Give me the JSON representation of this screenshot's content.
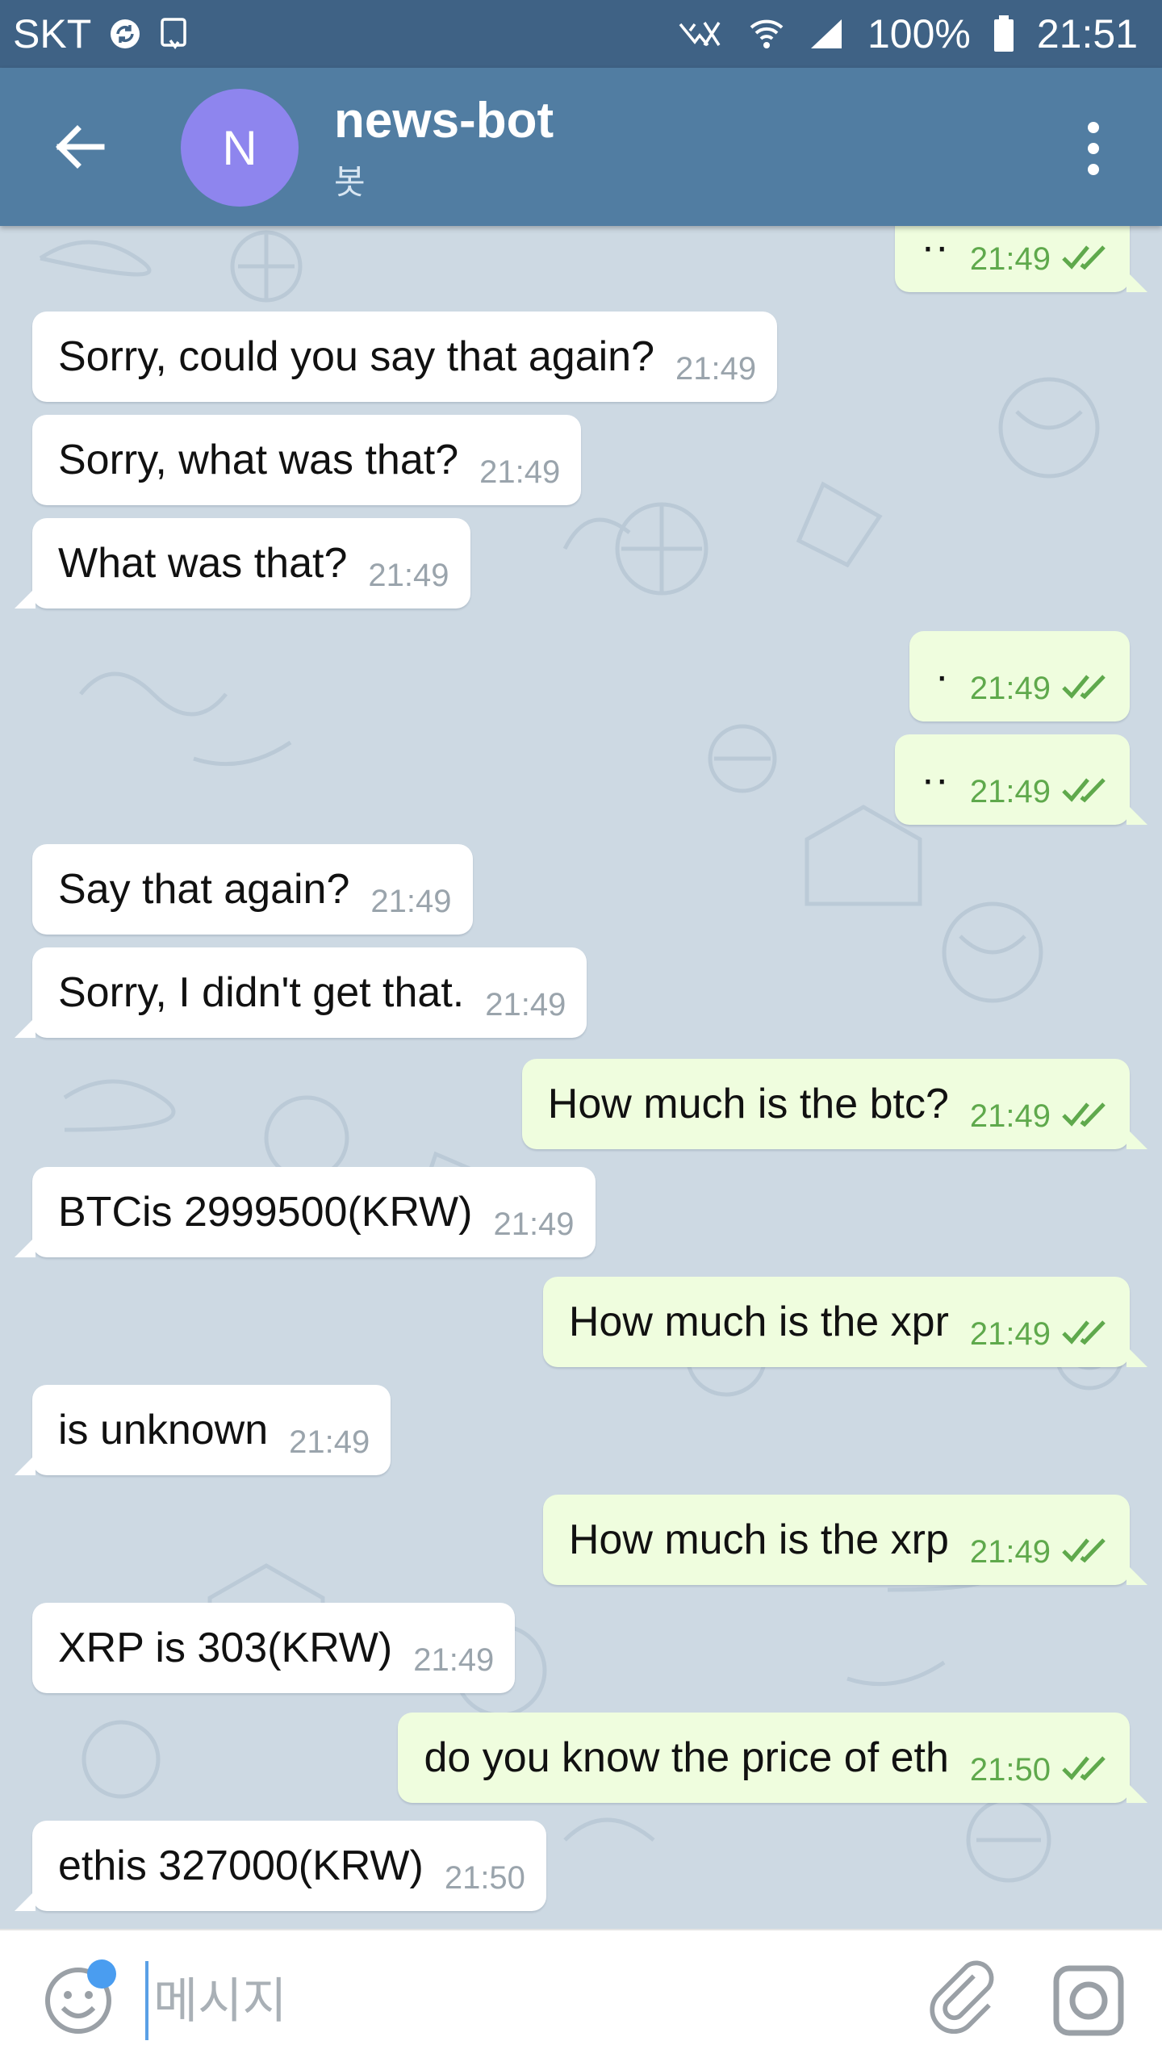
{
  "status_bar": {
    "carrier": "SKT",
    "battery": "100%",
    "time": "21:51"
  },
  "header": {
    "avatar_letter": "N",
    "title": "news-bot",
    "subtitle": "봇",
    "avatar_color": "#8e85ee",
    "bar_color": "#517da2"
  },
  "messages": [
    {
      "dir": "out",
      "text": "··",
      "time": "21:49",
      "read": true
    },
    {
      "dir": "in",
      "text": "Sorry, could you say that again?",
      "time": "21:49"
    },
    {
      "dir": "in",
      "text": "Sorry, what was that?",
      "time": "21:49"
    },
    {
      "dir": "in",
      "text": "What was that?",
      "time": "21:49"
    },
    {
      "dir": "out",
      "text": "·",
      "time": "21:49",
      "read": true
    },
    {
      "dir": "out",
      "text": "··",
      "time": "21:49",
      "read": true
    },
    {
      "dir": "in",
      "text": "Say that again?",
      "time": "21:49"
    },
    {
      "dir": "in",
      "text": "Sorry, I didn't get that.",
      "time": "21:49"
    },
    {
      "dir": "out",
      "text": "How much is the btc?",
      "time": "21:49",
      "read": true
    },
    {
      "dir": "in",
      "text": "BTCis 2999500(KRW)",
      "time": "21:49"
    },
    {
      "dir": "out",
      "text": "How much is the xpr",
      "time": "21:49",
      "read": true
    },
    {
      "dir": "in",
      "text": "is unknown",
      "time": "21:49"
    },
    {
      "dir": "out",
      "text": "How much is the xrp",
      "time": "21:49",
      "read": true
    },
    {
      "dir": "in",
      "text": "XRP is 303(KRW)",
      "time": "21:49"
    },
    {
      "dir": "out",
      "text": "do you know the price of eth",
      "time": "21:50",
      "read": true
    },
    {
      "dir": "in",
      "text": "ethis 327000(KRW)",
      "time": "21:50"
    }
  ],
  "input": {
    "placeholder": "메시지"
  },
  "icons": {
    "back": "arrow-left-icon",
    "menu": "vertical-dots-icon",
    "emoji": "smiley-icon",
    "attach": "paperclip-icon",
    "camera": "camera-icon",
    "read_receipt": "double-check-icon"
  },
  "colors": {
    "incoming_bubble": "#ffffff",
    "outgoing_bubble": "#effdde",
    "outgoing_time": "#5fa94c",
    "incoming_time": "#9aa4ac"
  }
}
